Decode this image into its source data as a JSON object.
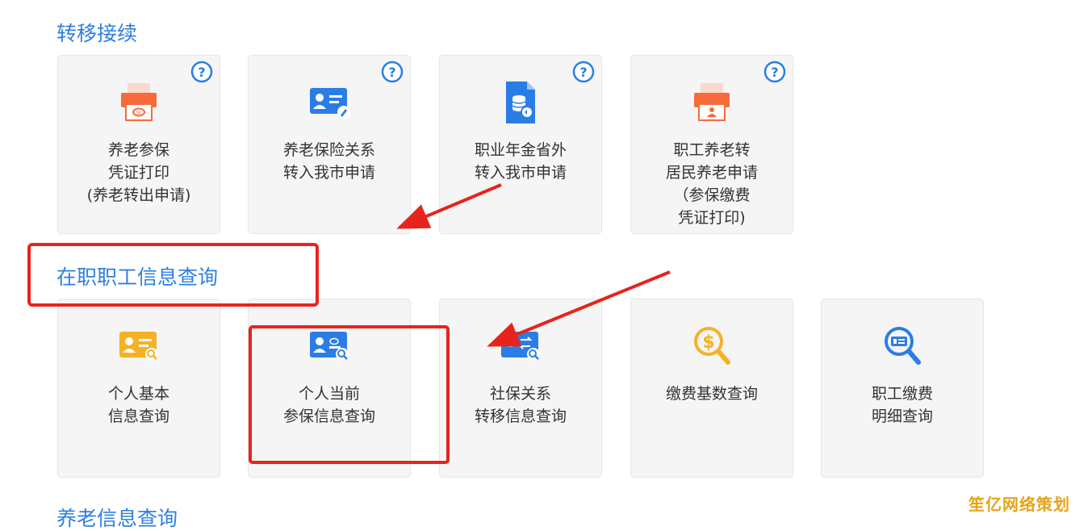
{
  "sections": [
    {
      "title": "转移接续",
      "cards": [
        {
          "label": "养老参保\n凭证打印\n(养老转出申请)",
          "icon": "printer-icon",
          "help": "?"
        },
        {
          "label": "养老保险关系\n转入我市申请",
          "icon": "id-card-edit-icon",
          "help": "?"
        },
        {
          "label": "职业年金省外\n转入我市申请",
          "icon": "database-document-icon",
          "help": "?"
        },
        {
          "label": "职工养老转\n居民养老申请\n（参保缴费\n凭证打印)",
          "icon": "printer-person-icon",
          "help": "?"
        }
      ]
    },
    {
      "title": "在职职工信息查询",
      "cards": [
        {
          "label": "个人基本\n信息查询",
          "icon": "id-card-search-icon"
        },
        {
          "label": "个人当前\n参保信息查询",
          "icon": "insurance-card-search-icon"
        },
        {
          "label": "社保关系\n转移信息查询",
          "icon": "transfer-card-search-icon"
        },
        {
          "label": "缴费基数查询",
          "icon": "dollar-search-icon"
        },
        {
          "label": "职工缴费\n明细查询",
          "icon": "detail-search-icon"
        }
      ]
    },
    {
      "title": "养老信息查询"
    }
  ],
  "watermark": "笙亿网络策划",
  "colors": {
    "title_blue": "#2f7fe0",
    "icon_orange": "#f76a3c",
    "icon_blue": "#2b7de6",
    "icon_yellow": "#f6b126",
    "annotation_red": "#e8231c",
    "card_bg": "#f5f5f5"
  }
}
